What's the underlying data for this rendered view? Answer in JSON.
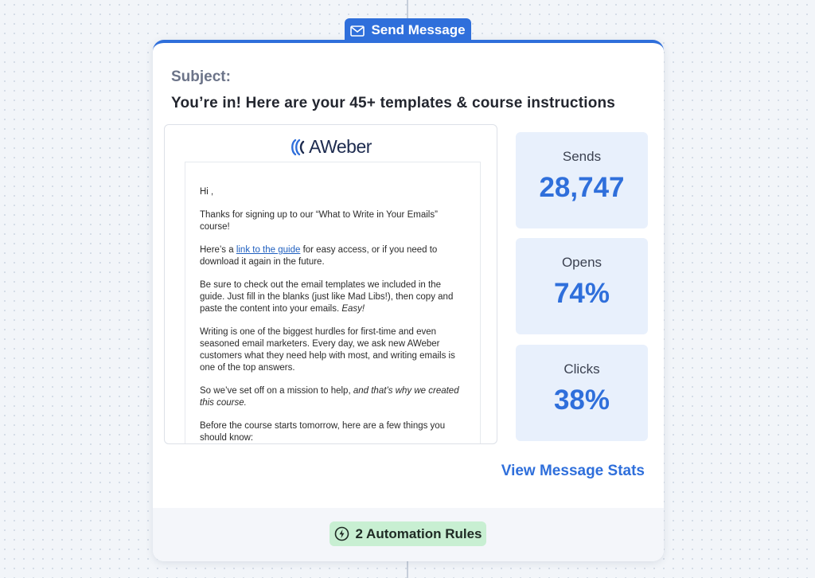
{
  "step": {
    "label": "Send Message",
    "icon": "mail-icon"
  },
  "subject": {
    "label": "Subject:",
    "text": "You’re in! Here are your 45+ templates & course instructions"
  },
  "email": {
    "logo_text": "AWeber",
    "greeting": "Hi ,",
    "p1": "Thanks for signing up to our “What to Write in Your Emails” course!",
    "p2_pre": "Here’s a ",
    "p2_link": "link to the guide",
    "p2_post": " for easy access, or if you need to download it again in the future.",
    "p3_main": "Be sure to check out the email templates we included in the guide. Just fill in the blanks (just like Mad Libs!), then copy and paste the content into your emails. ",
    "p3_em": "Easy!",
    "p4": "Writing is one of the biggest hurdles for first-time and even seasoned email marketers. Every day, we ask new AWeber customers what they need help with most, and writing emails is one of the top answers.",
    "p5_main": "So we’ve set off on a mission to help, ",
    "p5_em": "and that’s why we created this course.",
    "p6": "Before the course starts tomorrow, here are a few things you should know:"
  },
  "stats": [
    {
      "label": "Sends",
      "value": "28,747"
    },
    {
      "label": "Opens",
      "value": "74%"
    },
    {
      "label": "Clicks",
      "value": "38%"
    }
  ],
  "view_stats_label": "View Message Stats",
  "footer": {
    "rules_label": "2 Automation Rules",
    "icon": "bolt-icon"
  },
  "colors": {
    "accent": "#2f6fdb",
    "stat_bg": "#e8f0fc",
    "rules_bg": "#c8efd2"
  }
}
